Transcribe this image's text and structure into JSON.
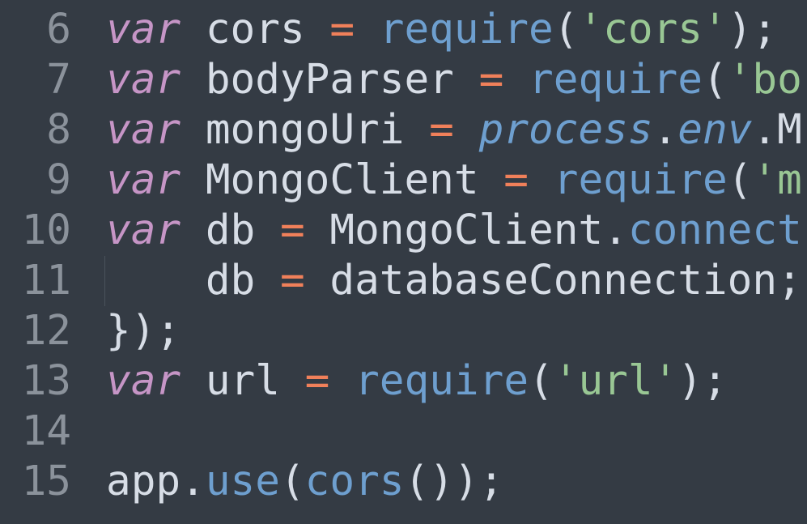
{
  "colors": {
    "background": "#343b44",
    "line_number": "#8b929b",
    "text": "#d7dde6",
    "keyword": "#c695c6",
    "operator": "#f0805a",
    "function": "#6e9fcf",
    "string": "#99c794"
  },
  "editor": {
    "lines": [
      {
        "number": "6",
        "tokens": [
          {
            "text": "var",
            "type": "keyword"
          },
          {
            "text": " cors ",
            "type": "text"
          },
          {
            "text": "=",
            "type": "operator"
          },
          {
            "text": " ",
            "type": "text"
          },
          {
            "text": "require",
            "type": "function"
          },
          {
            "text": "(",
            "type": "text"
          },
          {
            "text": "'cors'",
            "type": "string"
          },
          {
            "text": ");",
            "type": "text"
          }
        ]
      },
      {
        "number": "7",
        "tokens": [
          {
            "text": "var",
            "type": "keyword"
          },
          {
            "text": " bodyParser ",
            "type": "text"
          },
          {
            "text": "=",
            "type": "operator"
          },
          {
            "text": " ",
            "type": "text"
          },
          {
            "text": "require",
            "type": "function"
          },
          {
            "text": "(",
            "type": "text"
          },
          {
            "text": "'bo",
            "type": "string"
          }
        ]
      },
      {
        "number": "8",
        "tokens": [
          {
            "text": "var",
            "type": "keyword"
          },
          {
            "text": " mongoUri ",
            "type": "text"
          },
          {
            "text": "=",
            "type": "operator"
          },
          {
            "text": " ",
            "type": "text"
          },
          {
            "text": "process",
            "type": "function",
            "italic": true
          },
          {
            "text": ".",
            "type": "text"
          },
          {
            "text": "env",
            "type": "function",
            "italic": true
          },
          {
            "text": ".M",
            "type": "text"
          }
        ]
      },
      {
        "number": "9",
        "tokens": [
          {
            "text": "var",
            "type": "keyword"
          },
          {
            "text": " MongoClient ",
            "type": "text"
          },
          {
            "text": "=",
            "type": "operator"
          },
          {
            "text": " ",
            "type": "text"
          },
          {
            "text": "require",
            "type": "function"
          },
          {
            "text": "(",
            "type": "text"
          },
          {
            "text": "'m",
            "type": "string"
          }
        ]
      },
      {
        "number": "10",
        "tokens": [
          {
            "text": "var",
            "type": "keyword"
          },
          {
            "text": " db ",
            "type": "text"
          },
          {
            "text": "=",
            "type": "operator"
          },
          {
            "text": " MongoClient.",
            "type": "text"
          },
          {
            "text": "connect",
            "type": "function"
          }
        ]
      },
      {
        "number": "11",
        "indent_guide": true,
        "tokens": [
          {
            "text": "    db ",
            "type": "text"
          },
          {
            "text": "=",
            "type": "operator"
          },
          {
            "text": " databaseConnection;",
            "type": "text"
          }
        ]
      },
      {
        "number": "12",
        "tokens": [
          {
            "text": "});",
            "type": "text"
          }
        ]
      },
      {
        "number": "13",
        "tokens": [
          {
            "text": "var",
            "type": "keyword"
          },
          {
            "text": " url ",
            "type": "text"
          },
          {
            "text": "=",
            "type": "operator"
          },
          {
            "text": " ",
            "type": "text"
          },
          {
            "text": "require",
            "type": "function"
          },
          {
            "text": "(",
            "type": "text"
          },
          {
            "text": "'url'",
            "type": "string"
          },
          {
            "text": ");",
            "type": "text"
          }
        ]
      },
      {
        "number": "14",
        "tokens": []
      },
      {
        "number": "15",
        "tokens": [
          {
            "text": "app.",
            "type": "text"
          },
          {
            "text": "use",
            "type": "function"
          },
          {
            "text": "(",
            "type": "text"
          },
          {
            "text": "cors",
            "type": "function"
          },
          {
            "text": "());",
            "type": "text"
          }
        ]
      }
    ]
  }
}
